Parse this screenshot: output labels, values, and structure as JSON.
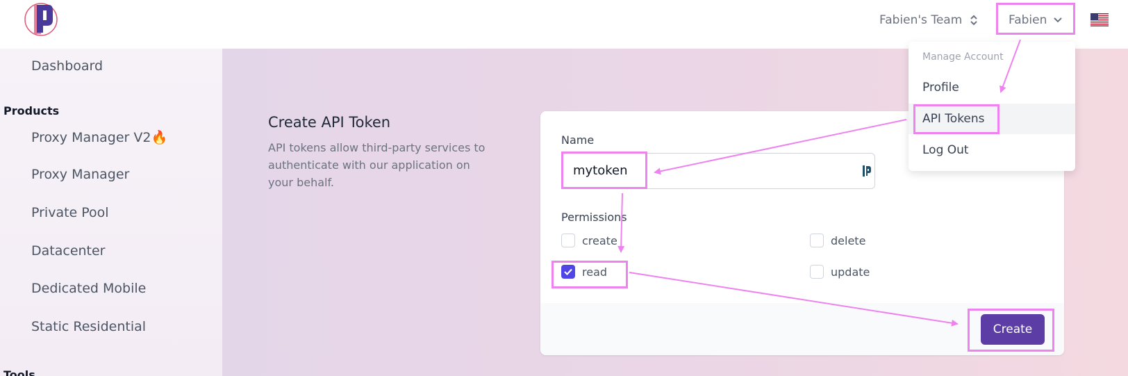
{
  "header": {
    "team_name": "Fabien's Team",
    "user_name": "Fabien"
  },
  "sidebar": {
    "items": [
      {
        "label": "Dashboard"
      },
      {
        "heading": "Products"
      },
      {
        "label": "Proxy Manager V2🔥"
      },
      {
        "label": "Proxy Manager"
      },
      {
        "label": "Private Pool"
      },
      {
        "label": "Datacenter"
      },
      {
        "label": "Dedicated Mobile"
      },
      {
        "label": "Static Residential"
      },
      {
        "heading": "Tools"
      }
    ]
  },
  "main": {
    "title": "Create API Token",
    "description": "API tokens allow third-party services to authenticate with our application on your behalf.",
    "form": {
      "name_label": "Name",
      "name_value": "mytoken",
      "permissions_label": "Permissions",
      "permissions": [
        {
          "label": "create",
          "checked": false
        },
        {
          "label": "delete",
          "checked": false
        },
        {
          "label": "read",
          "checked": true
        },
        {
          "label": "update",
          "checked": false
        }
      ],
      "submit_label": "Create"
    }
  },
  "account_menu": {
    "header": "Manage Account",
    "items": [
      {
        "label": "Profile"
      },
      {
        "label": "API Tokens",
        "active": true
      },
      {
        "label": "Log Out"
      }
    ]
  },
  "colors": {
    "accent": "#5b3da5",
    "checkbox": "#4f46e5",
    "annotation": "#ee82ee"
  }
}
